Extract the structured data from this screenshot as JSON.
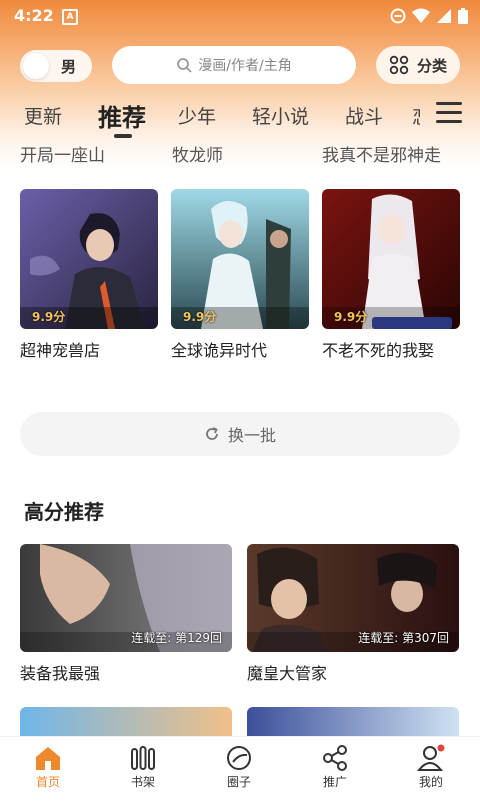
{
  "status_bar": {
    "time": "4:22",
    "icons": [
      "a-notification-icon",
      "minus-circle-icon",
      "wifi-icon",
      "signal-icon",
      "battery-icon"
    ]
  },
  "header": {
    "gender_toggle_label": "男",
    "search_placeholder": "漫画/作者/主角",
    "category_button_label": "分类"
  },
  "tabs": [
    "更新",
    "推荐",
    "少年",
    "轻小说",
    "战斗",
    "恋"
  ],
  "active_tab": "推荐",
  "cut_titles": [
    "开局一座山",
    "牧龙师",
    "我真不是邪神走"
  ],
  "cards": [
    {
      "title": "超神宠兽店",
      "score": "9.9分"
    },
    {
      "title": "全球诡异时代",
      "score": "9.9分"
    },
    {
      "title": "不老不死的我娶",
      "score": "9.9分"
    }
  ],
  "refresh_label": "换一批",
  "section": {
    "title": "高分推荐"
  },
  "wide_cards": [
    {
      "title": "装备我最强",
      "progress": "连载至: 第129回"
    },
    {
      "title": "魔皇大管家",
      "progress": "连载至: 第307回"
    }
  ],
  "nav": [
    {
      "label": "首页",
      "icon": "home-icon"
    },
    {
      "label": "书架",
      "icon": "bookshelf-icon"
    },
    {
      "label": "圈子",
      "icon": "circle-icon"
    },
    {
      "label": "推广",
      "icon": "share-icon"
    },
    {
      "label": "我的",
      "icon": "profile-icon"
    }
  ],
  "colors": {
    "accent": "#f0882e",
    "header_gradient_top": "#f08a3c",
    "score": "#f4c35a"
  }
}
